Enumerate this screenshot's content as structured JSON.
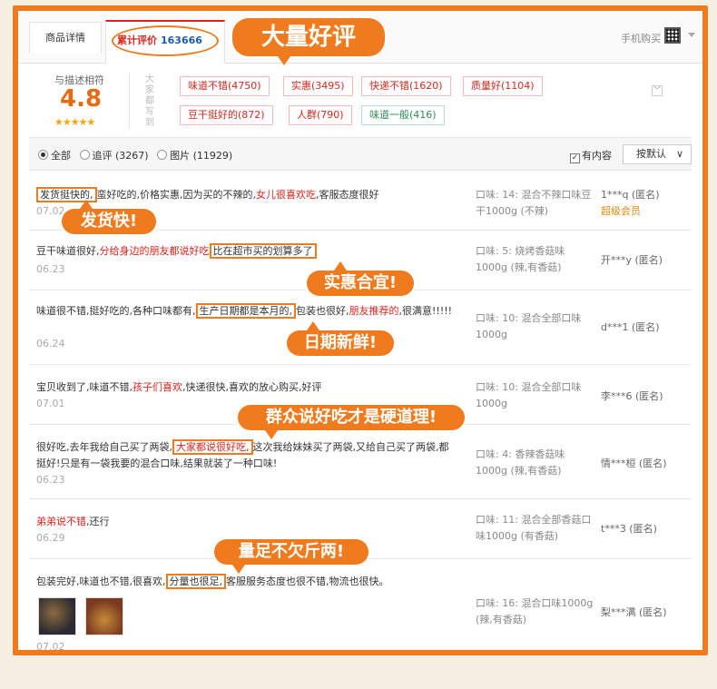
{
  "tabs": {
    "details": "商品详情",
    "reviews_label": "累计评价",
    "reviews_count": "163666",
    "mobile_buy": "手机购买"
  },
  "rating": {
    "label": "与描述相符",
    "score": "4.8",
    "stars": "★★★★★",
    "vertical_label": "大家都写到",
    "tags": [
      {
        "text": "味道不错(4750)"
      },
      {
        "text": "实惠(3495)"
      },
      {
        "text": "快递不错(1620)"
      },
      {
        "text": "质量好(1104)"
      },
      {
        "text": "豆干挺好的(872)"
      },
      {
        "text": "人群(790)"
      },
      {
        "text": "味道一般(416)"
      }
    ],
    "expand": "﹀"
  },
  "filter": {
    "all": "全部",
    "followup": "追评 (3267)",
    "images": "图片 (11929)",
    "has_content": "有内容",
    "sort": "按默认"
  },
  "callouts": {
    "main": "大量好评",
    "c1": "发货快!",
    "c2": "实惠合宜!",
    "c3": "日期新鲜!",
    "c4": "群众说好吃才是硬道理!",
    "c5": "量足不欠斤两!"
  },
  "reviews": [
    {
      "seg": [
        "发货挺快的,",
        "蛮好吃的,价格实惠,因为买的不辣的,",
        "女儿很喜欢吃",
        ",客服态度很好"
      ],
      "date": "07.02",
      "sku": "口味: 14: 混合不辣口味豆干1000g (不辣)",
      "user": "1***q (匿名)",
      "vip": "超级会员"
    },
    {
      "seg": [
        "豆干味道很好,",
        "分给身边的朋友都说好吃",
        "比在超市买的划算多了"
      ],
      "date": "06.23",
      "sku": "口味: 5: 烧烤香菇味1000g (辣,有香菇)",
      "user": "开***y (匿名)"
    },
    {
      "seg": [
        "味道很不错,挺好吃的,各种口味都有,",
        "生产日期都是本月的,",
        "包装也很好,",
        "朋友推荐的",
        ",很满意!!!!!"
      ],
      "date": "06.24",
      "sku": "口味: 10: 混合全部口味1000g",
      "user": "d***1 (匿名)"
    },
    {
      "seg": [
        "宝贝收到了,味道不错,",
        "孩子们喜欢",
        ",快递很快,喜欢的放心购买,好评"
      ],
      "date": "07.01",
      "sku": "口味: 10: 混合全部口味1000g",
      "user": "李***6 (匿名)"
    },
    {
      "seg": [
        "很好吃,去年我给自己买了两袋,",
        "大家都说很好吃,",
        "这次我给妹妹买了两袋,又给自己买了两袋,都挺好!只是有一袋我要的混合口味,结果就装了一种口味!"
      ],
      "date": "06.23",
      "sku": "口味: 4: 香辣香菇味1000g (辣,有香菇)",
      "user": "情***桓 (匿名)"
    },
    {
      "seg": [
        "弟弟说不错",
        ",还行"
      ],
      "date": "06.29",
      "sku": "口味: 11: 混合全部香菇口味1000g (有香菇)",
      "user": "t***3 (匿名)"
    },
    {
      "seg": [
        "包装完好,味道也不错,很喜欢,",
        "分量也很足,",
        "客服服务态度也很不错,物流也很快。"
      ],
      "date": "07.02",
      "sku": "口味: 16: 混合口味1000g (辣,有香菇)",
      "user": "梨***满 (匿名)"
    }
  ],
  "colors": {
    "accent": "#f07a1e",
    "highlight": "#e2231a",
    "score": "#e66a10"
  }
}
